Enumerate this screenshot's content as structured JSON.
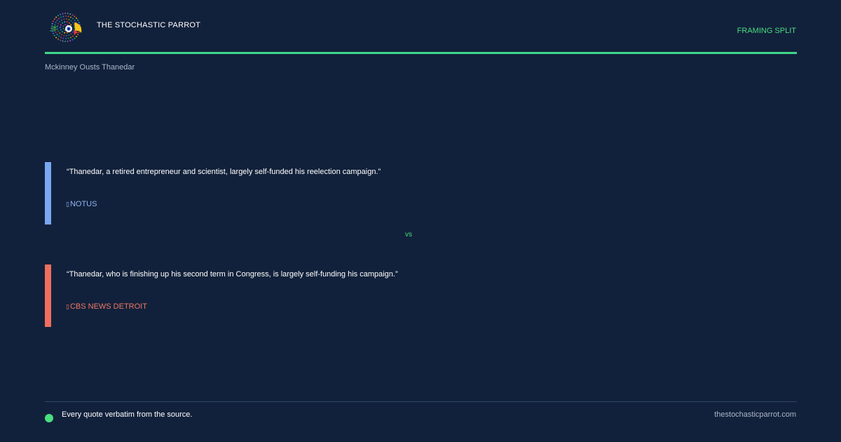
{
  "brand": {
    "name": "THE STOCHASTIC PARROT",
    "logo_icon": "parrot-logo-icon"
  },
  "header": {
    "tag": "FRAMING SPLIT",
    "accent_color": "#3dd68c"
  },
  "headline": "Mckinney Ousts Thanedar",
  "quotes": [
    {
      "text": "“Thanedar, a retired entrepreneur and scientist, largely self-funded his reelection campaign.”",
      "source": "NOTUS",
      "source_icon": "source-icon",
      "color": "#7aa7f2"
    },
    {
      "text": "“Thanedar, who is finishing up his second term in Congress, is largely self-funding his campaign.”",
      "source": "CBS NEWS DETROIT",
      "source_icon": "source-icon",
      "color": "#ef6f5e"
    }
  ],
  "divider": "vs",
  "footer": {
    "note": "Every quote verbatim from the source.",
    "url": "thestochasticparrot.com"
  },
  "colors": {
    "background": "#12213b",
    "accent": "#4ade80"
  }
}
